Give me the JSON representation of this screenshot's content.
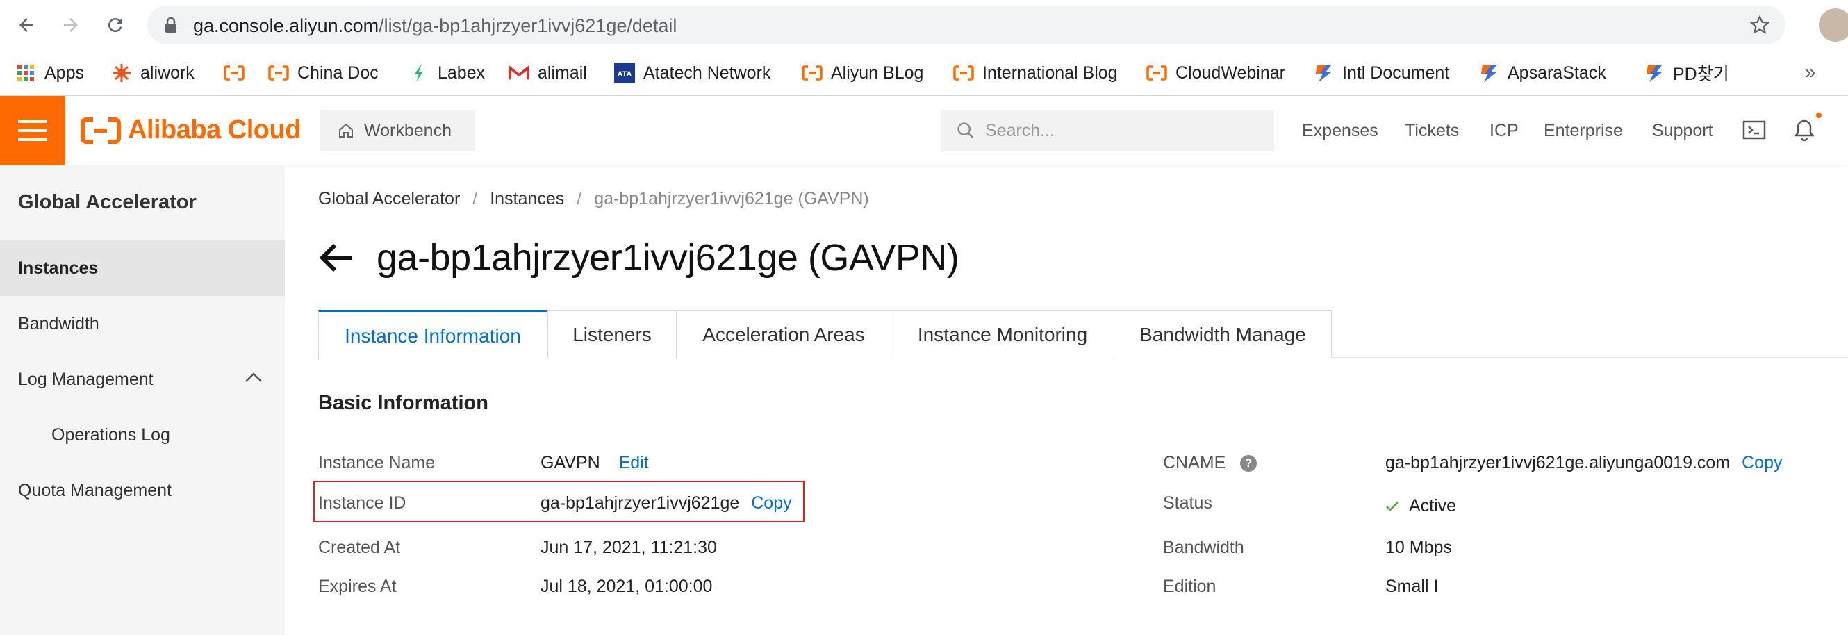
{
  "browser": {
    "url_host": "ga.console.aliyun.com",
    "url_path": "/list/ga-bp1ahjrzyer1ivvj621ge/detail",
    "bookmarks": [
      {
        "label": "Apps",
        "icon": "apps-grid-icon"
      },
      {
        "label": "aliwork",
        "icon": "aliwork-icon"
      },
      {
        "label": "",
        "icon": "alibaba-bracket-icon"
      },
      {
        "label": "China Doc",
        "icon": "alibaba-bracket-icon"
      },
      {
        "label": "Labex",
        "icon": "labex-leaf-icon"
      },
      {
        "label": "alimail",
        "icon": "gmail-m-icon"
      },
      {
        "label": "Atatech Network",
        "icon": "ata-icon"
      },
      {
        "label": "Aliyun BLog",
        "icon": "alibaba-bracket-icon"
      },
      {
        "label": "International Blog",
        "icon": "alibaba-bracket-icon"
      },
      {
        "label": "CloudWebinar",
        "icon": "alibaba-bracket-icon"
      },
      {
        "label": "Intl Document",
        "icon": "stack-icon"
      },
      {
        "label": "ApsaraStack",
        "icon": "stack-icon"
      },
      {
        "label": "PD찾기",
        "icon": "stack-icon"
      }
    ],
    "more": "»"
  },
  "topbar": {
    "logo_text": "Alibaba Cloud",
    "workbench_label": "Workbench",
    "search_placeholder": "Search...",
    "links": [
      "Expenses",
      "Tickets",
      "ICP",
      "Enterprise",
      "Support"
    ]
  },
  "sidebar": {
    "title": "Global Accelerator",
    "items": [
      {
        "label": "Instances",
        "active": true
      },
      {
        "label": "Bandwidth",
        "active": false
      },
      {
        "label": "Log Management",
        "active": false,
        "expanded": true
      },
      {
        "label": "Operations Log",
        "active": false,
        "sub": true
      },
      {
        "label": "Quota Management",
        "active": false
      }
    ]
  },
  "breadcrumb": {
    "items": [
      "Global Accelerator",
      "Instances",
      "ga-bp1ahjrzyer1ivvj621ge (GAVPN)"
    ],
    "separator": "/"
  },
  "page": {
    "title": "ga-bp1ahjrzyer1ivvj621ge (GAVPN)",
    "tabs": [
      "Instance Information",
      "Listeners",
      "Acceleration Areas",
      "Instance Monitoring",
      "Bandwidth Manage"
    ],
    "active_tab": "Instance Information",
    "section_title": "Basic Information"
  },
  "basic_info": {
    "left": [
      {
        "label": "Instance Name",
        "value": "GAVPN",
        "action": "Edit"
      },
      {
        "label": "Instance ID",
        "value": "ga-bp1ahjrzyer1ivvj621ge",
        "action": "Copy"
      },
      {
        "label": "Created At",
        "value": "Jun 17, 2021, 11:21:30"
      },
      {
        "label": "Expires At",
        "value": "Jul 18, 2021, 01:00:00"
      }
    ],
    "right": [
      {
        "label": "CNAME",
        "value": "ga-bp1ahjrzyer1ivvj621ge.aliyunga0019.com",
        "action": "Copy",
        "help": "?"
      },
      {
        "label": "Status",
        "value": "Active"
      },
      {
        "label": "Bandwidth",
        "value": "10 Mbps"
      },
      {
        "label": "Edition",
        "value": "Small I"
      }
    ]
  },
  "colors": {
    "brand": "#ff6a00",
    "link": "#0070cc",
    "highlight": "#e02020",
    "status_ok": "#52a83a"
  }
}
